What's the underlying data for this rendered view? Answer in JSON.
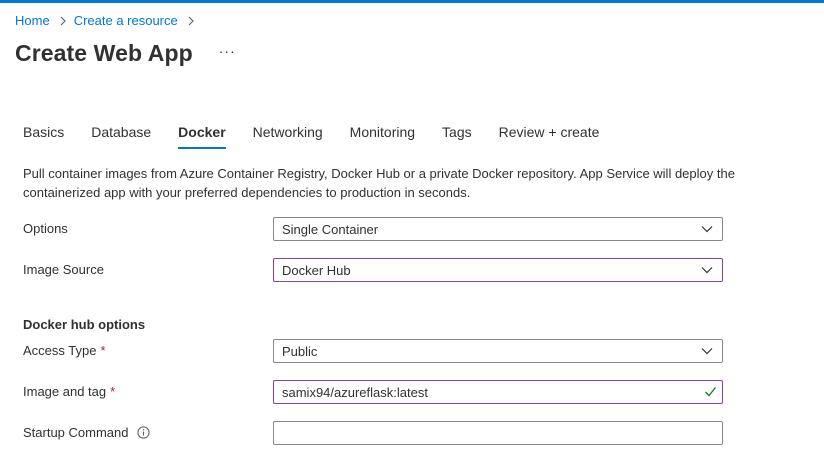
{
  "breadcrumb": {
    "items": [
      "Home",
      "Create a resource"
    ]
  },
  "header": {
    "title": "Create Web App",
    "more": "···"
  },
  "tabs": [
    {
      "label": "Basics"
    },
    {
      "label": "Database"
    },
    {
      "label": "Docker",
      "active": true
    },
    {
      "label": "Networking"
    },
    {
      "label": "Monitoring"
    },
    {
      "label": "Tags"
    },
    {
      "label": "Review + create"
    }
  ],
  "description": "Pull container images from Azure Container Registry, Docker Hub or a private Docker repository. App Service will deploy the containerized app with your preferred dependencies to production in seconds.",
  "form": {
    "options": {
      "label": "Options",
      "value": "Single Container"
    },
    "image_source": {
      "label": "Image Source",
      "value": "Docker Hub"
    },
    "docker_hub_heading": "Docker hub options",
    "access_type": {
      "label": "Access Type",
      "required": "*",
      "value": "Public"
    },
    "image_tag": {
      "label": "Image and tag",
      "required": "*",
      "value": "samix94/azureflask:latest"
    },
    "startup_command": {
      "label": "Startup Command",
      "value": ""
    }
  },
  "colors": {
    "accent": "#0078d4",
    "focus_border": "#8a3fa0",
    "required": "#a4262c",
    "valid": "#107c10"
  },
  "icons": {
    "separator": "chevron-right-icon",
    "dropdown": "chevron-down-icon",
    "info": "info-icon",
    "valid": "checkmark-icon"
  }
}
